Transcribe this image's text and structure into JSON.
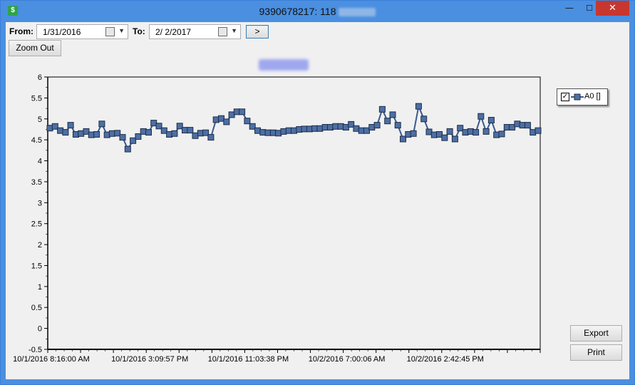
{
  "window": {
    "title": "9390678217: 118",
    "minimize_glyph": "—",
    "maximize_glyph": "☐",
    "close_glyph": "✕"
  },
  "toolbar": {
    "from_label": "From:",
    "from_value": "1/31/2016",
    "to_label": "To:",
    "to_value": "2/  2/2017",
    "go_label": ">",
    "zoom_out_label": "Zoom Out"
  },
  "buttons": {
    "export_label": "Export",
    "print_label": "Print"
  },
  "legend": {
    "series_name": "A0 []",
    "checked": true
  },
  "colors": {
    "series": "#3a5a8c",
    "marker_fill": "#4d6fa3",
    "titlebar": "#4a8fe0",
    "close": "#c7372f"
  },
  "chart_data": {
    "type": "line",
    "ylim": [
      -0.5,
      6
    ],
    "yticks": [
      "6",
      "5.5",
      "5",
      "4.5",
      "4",
      "3.5",
      "3",
      "2.5",
      "2",
      "1.5",
      "1",
      "0.5",
      "0",
      "-0.5"
    ],
    "xtick_labels": [
      "10/1/2016 8:16:00 AM",
      "10/1/2016 3:09:57 PM",
      "10/1/2016 11:03:38 PM",
      "10/2/2016 7:00:06 AM",
      "10/2/2016 2:42:45 PM"
    ],
    "series": [
      {
        "name": "A0 []",
        "values": [
          4.78,
          4.82,
          4.72,
          4.68,
          4.85,
          4.63,
          4.65,
          4.7,
          4.62,
          4.63,
          4.88,
          4.62,
          4.65,
          4.66,
          4.56,
          4.28,
          4.48,
          4.58,
          4.7,
          4.68,
          4.9,
          4.83,
          4.72,
          4.63,
          4.65,
          4.83,
          4.73,
          4.73,
          4.6,
          4.66,
          4.67,
          4.56,
          4.98,
          5.01,
          4.93,
          5.1,
          5.17,
          5.17,
          4.95,
          4.82,
          4.72,
          4.68,
          4.67,
          4.67,
          4.66,
          4.7,
          4.72,
          4.72,
          4.75,
          4.76,
          4.76,
          4.77,
          4.77,
          4.8,
          4.8,
          4.82,
          4.82,
          4.8,
          4.87,
          4.77,
          4.72,
          4.72,
          4.8,
          4.85,
          5.23,
          4.95,
          5.1,
          4.85,
          4.52,
          4.63,
          4.65,
          5.3,
          5.0,
          4.69,
          4.62,
          4.63,
          4.55,
          4.7,
          4.52,
          4.78,
          4.68,
          4.7,
          4.68,
          5.06,
          4.7,
          4.97,
          4.62,
          4.64,
          4.8,
          4.8,
          4.88,
          4.85,
          4.85,
          4.68,
          4.72
        ]
      }
    ]
  }
}
